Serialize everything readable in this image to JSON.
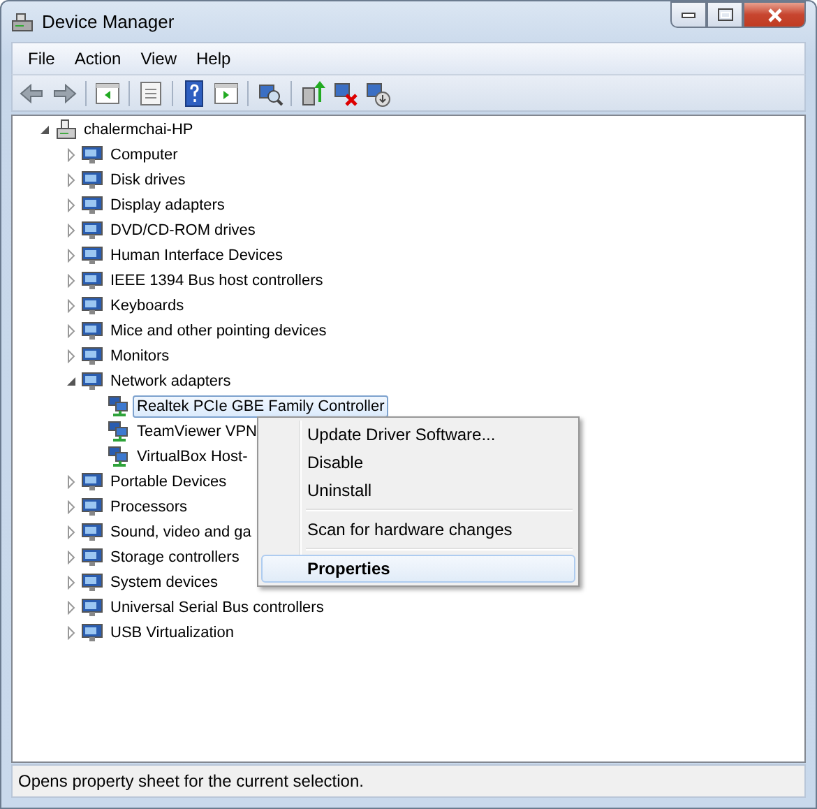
{
  "window": {
    "title": "Device Manager"
  },
  "menu_bar": [
    "File",
    "Action",
    "View",
    "Help"
  ],
  "tree": {
    "label": "chalermchai-HP",
    "expanded": true,
    "children": [
      {
        "label": "Computer",
        "expanded": false
      },
      {
        "label": "Disk drives",
        "expanded": false
      },
      {
        "label": "Display adapters",
        "expanded": false
      },
      {
        "label": "DVD/CD-ROM drives",
        "expanded": false
      },
      {
        "label": "Human Interface Devices",
        "expanded": false
      },
      {
        "label": "IEEE 1394 Bus host controllers",
        "expanded": false
      },
      {
        "label": "Keyboards",
        "expanded": false
      },
      {
        "label": "Mice and other pointing devices",
        "expanded": false
      },
      {
        "label": "Monitors",
        "expanded": false
      },
      {
        "label": "Network adapters",
        "expanded": true,
        "children": [
          {
            "label": "Realtek PCIe GBE Family Controller",
            "selected": true
          },
          {
            "label": "TeamViewer VPN",
            "selected": false
          },
          {
            "label": "VirtualBox Host-",
            "selected": false
          }
        ]
      },
      {
        "label": "Portable Devices",
        "expanded": false
      },
      {
        "label": "Processors",
        "expanded": false
      },
      {
        "label": "Sound, video and ga",
        "expanded": false
      },
      {
        "label": "Storage controllers",
        "expanded": false
      },
      {
        "label": "System devices",
        "expanded": false
      },
      {
        "label": "Universal Serial Bus controllers",
        "expanded": false
      },
      {
        "label": "USB Virtualization",
        "expanded": false
      }
    ]
  },
  "context_menu": [
    {
      "kind": "item",
      "label": "Update Driver Software...",
      "selected": false,
      "default": false
    },
    {
      "kind": "item",
      "label": "Disable",
      "selected": false,
      "default": false
    },
    {
      "kind": "item",
      "label": "Uninstall",
      "selected": false,
      "default": false
    },
    {
      "kind": "separator"
    },
    {
      "kind": "item",
      "label": "Scan for hardware changes",
      "selected": false,
      "default": false
    },
    {
      "kind": "separator"
    },
    {
      "kind": "item",
      "label": "Properties",
      "selected": true,
      "default": true
    }
  ],
  "status_bar": "Opens property sheet for the current selection."
}
